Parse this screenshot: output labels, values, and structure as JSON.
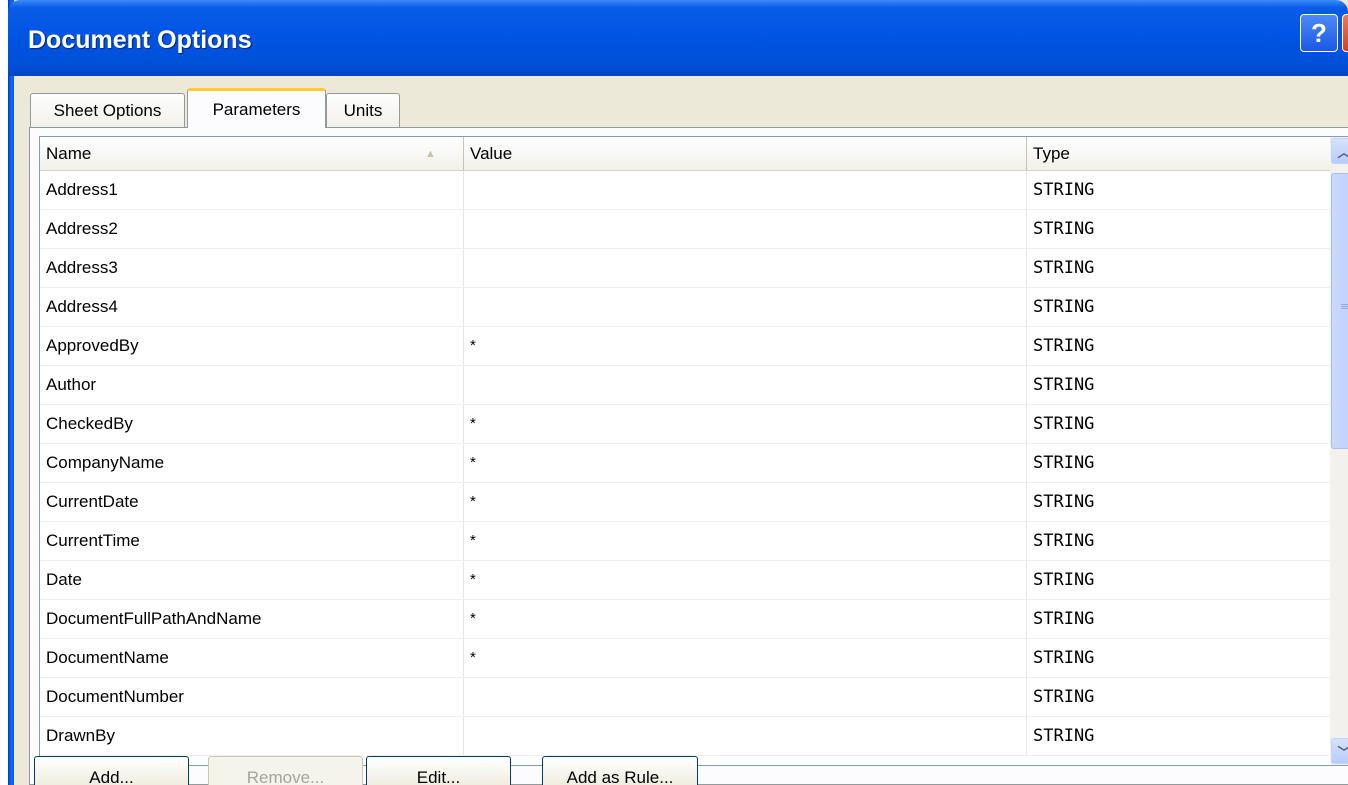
{
  "window": {
    "title": "Document Options",
    "help_glyph": "?",
    "close_glyph": "✕"
  },
  "tabs": [
    {
      "label": "Sheet Options",
      "active": false
    },
    {
      "label": "Parameters",
      "active": true
    },
    {
      "label": "Units",
      "active": false
    }
  ],
  "table": {
    "columns": [
      "Name",
      "Value",
      "Type"
    ],
    "sort_column": "Name",
    "sort_glyph": "▲",
    "rows": [
      {
        "name": "Address1",
        "value": "",
        "type": "STRING"
      },
      {
        "name": "Address2",
        "value": "",
        "type": "STRING"
      },
      {
        "name": "Address3",
        "value": "",
        "type": "STRING"
      },
      {
        "name": "Address4",
        "value": "",
        "type": "STRING"
      },
      {
        "name": "ApprovedBy",
        "value": "*",
        "type": "STRING"
      },
      {
        "name": "Author",
        "value": "",
        "type": "STRING"
      },
      {
        "name": "CheckedBy",
        "value": "*",
        "type": "STRING"
      },
      {
        "name": "CompanyName",
        "value": "*",
        "type": "STRING"
      },
      {
        "name": "CurrentDate",
        "value": "*",
        "type": "STRING"
      },
      {
        "name": "CurrentTime",
        "value": "*",
        "type": "STRING"
      },
      {
        "name": "Date",
        "value": "*",
        "type": "STRING"
      },
      {
        "name": "DocumentFullPathAndName",
        "value": "*",
        "type": "STRING"
      },
      {
        "name": "DocumentName",
        "value": "*",
        "type": "STRING"
      },
      {
        "name": "DocumentNumber",
        "value": "",
        "type": "STRING"
      },
      {
        "name": "DrawnBy",
        "value": "",
        "type": "STRING"
      }
    ]
  },
  "scrollbar": {
    "up_glyph": "︿",
    "down_glyph": "﹀",
    "grip_glyph": "≡"
  },
  "buttons": {
    "add": "Add...",
    "remove": "Remove...",
    "edit": "Edit...",
    "add_as_rule": "Add as Rule..."
  }
}
